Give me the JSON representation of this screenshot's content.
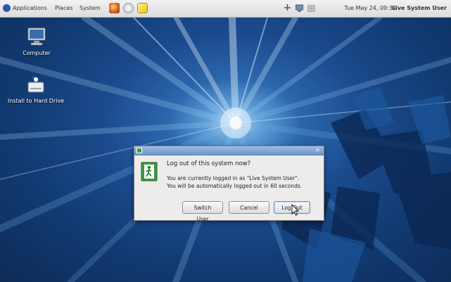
{
  "top_panel": {
    "menus": [
      "Applications",
      "Places",
      "System"
    ],
    "clock": "Tue May 24, 09:34",
    "user": "Live System User"
  },
  "desktop": {
    "icons": [
      {
        "label": "Computer",
        "icon": "computer-icon"
      },
      {
        "label": "Install to Hard Drive",
        "icon": "install-drive-icon"
      }
    ]
  },
  "dialog": {
    "heading": "Log out of this system now?",
    "message_line1": "You are currently logged in as \"Live System User\".",
    "message_line2": "You will be automatically logged out in 60 seconds.",
    "buttons": {
      "switch_user": "Switch User",
      "cancel": "Cancel",
      "log_out": "Log Out"
    }
  }
}
